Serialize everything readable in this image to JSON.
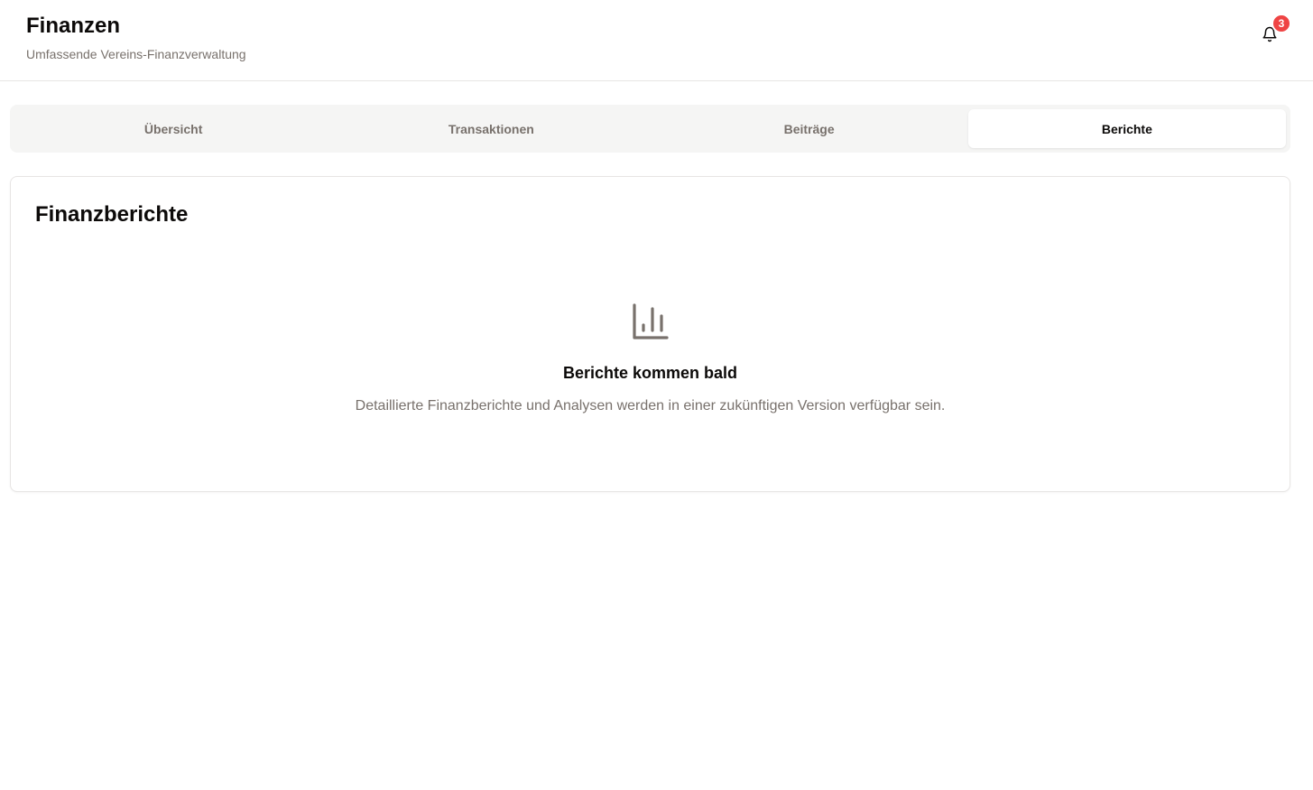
{
  "header": {
    "title": "Finanzen",
    "subtitle": "Umfassende Vereins-Finanzverwaltung",
    "notifications": {
      "icon": "bell-icon",
      "count": "3",
      "badge_color": "#ef4444"
    }
  },
  "tabs": [
    {
      "label": "Übersicht",
      "active": false
    },
    {
      "label": "Transaktionen",
      "active": false
    },
    {
      "label": "Beiträge",
      "active": false
    },
    {
      "label": "Berichte",
      "active": true
    }
  ],
  "reports": {
    "title": "Finanzberichte",
    "empty_state": {
      "icon": "bar-chart-icon",
      "heading": "Berichte kommen bald",
      "text": "Detaillierte Finanzberichte und Analysen werden in einer zukünftigen Version verfügbar sein."
    }
  },
  "colors": {
    "text_primary": "#0c0a09",
    "text_muted": "#78716c",
    "tab_bg": "#f5f5f4",
    "border": "#e7e5e4"
  }
}
